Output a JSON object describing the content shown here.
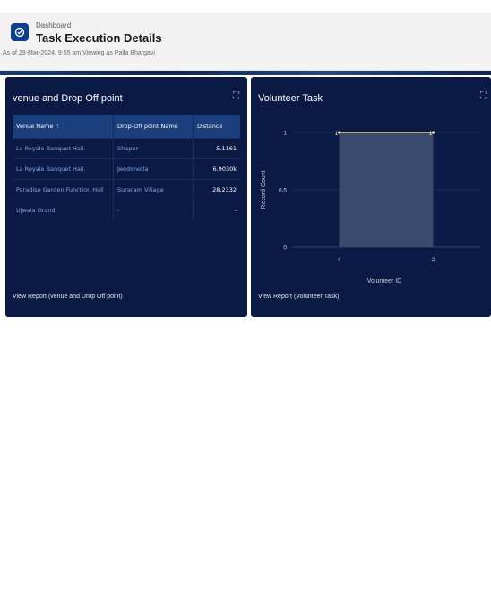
{
  "header": {
    "breadcrumb": "Dashboard",
    "title": "Task Execution Details",
    "meta": "As of 29-Mar-2024, 9:55 am Viewing as Palla Bhargavi"
  },
  "venue_panel": {
    "title": "venue and Drop Off point",
    "columns": [
      "Venue Name",
      "Drop-Off point Name",
      "Distance"
    ],
    "sort_indicator": "↑",
    "rows": [
      {
        "venue": "La Royale Banquet Hall.",
        "dropoff": "Shapur",
        "distance": "5.1161"
      },
      {
        "venue": "La Royale Banquet Hall.",
        "dropoff": "Jeedimetla",
        "distance": "6.9030k"
      },
      {
        "venue": "Paradise Garden Function Hall",
        "dropoff": "Suraram Village",
        "distance": "28.2332"
      },
      {
        "venue": "Ujwala Grand",
        "dropoff": "-",
        "distance": "-"
      }
    ],
    "footer_link": "View Report (venue and Drop Off point)"
  },
  "volunteer_panel": {
    "title": "Volunteer Task",
    "footer_link": "View Report (Volunteer Task)"
  },
  "colors": {
    "panel_bg": "#0b1a45",
    "table_header": "#1b3e7c",
    "link": "#7fa6e6",
    "bar": "#3a4a6c",
    "line": "#f3e79a"
  },
  "chart_data": {
    "type": "bar",
    "categories": [
      "4",
      "2"
    ],
    "values": [
      1,
      1
    ],
    "point_labels": [
      "1",
      "1"
    ],
    "xlabel": "Volunteer ID",
    "ylabel": "Record Count",
    "yticks": [
      "0",
      "0.5",
      "1"
    ],
    "ylim": [
      0,
      1
    ],
    "grid": true
  }
}
